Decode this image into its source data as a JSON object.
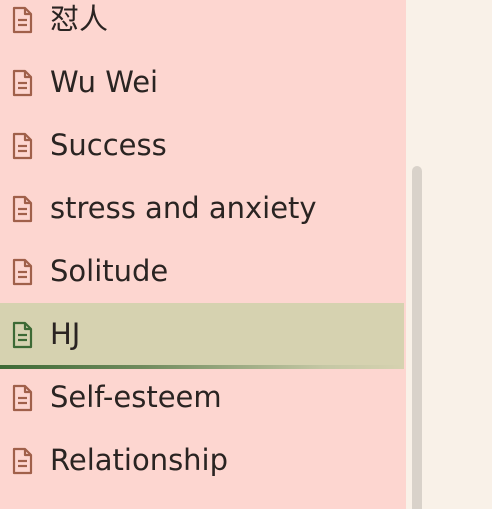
{
  "sidebar": {
    "items": [
      {
        "label": "怼人",
        "icon": "document-icon",
        "active": false
      },
      {
        "label": "Wu Wei",
        "icon": "document-icon",
        "active": false
      },
      {
        "label": "Success",
        "icon": "document-icon",
        "active": false
      },
      {
        "label": "stress and anxiety",
        "icon": "document-icon",
        "active": false
      },
      {
        "label": "Solitude",
        "icon": "document-icon",
        "active": false
      },
      {
        "label": "HJ",
        "icon": "document-icon",
        "active": true
      },
      {
        "label": "Self-esteem",
        "icon": "document-icon",
        "active": false
      },
      {
        "label": "Relationship",
        "icon": "document-icon",
        "active": false
      }
    ]
  },
  "colors": {
    "sidebar_bg": "#fdd6d0",
    "page_bg": "#f9f1e8",
    "active_bg": "#d6d2b0",
    "icon_default": "#a0604a",
    "icon_active": "#3d6a35"
  }
}
